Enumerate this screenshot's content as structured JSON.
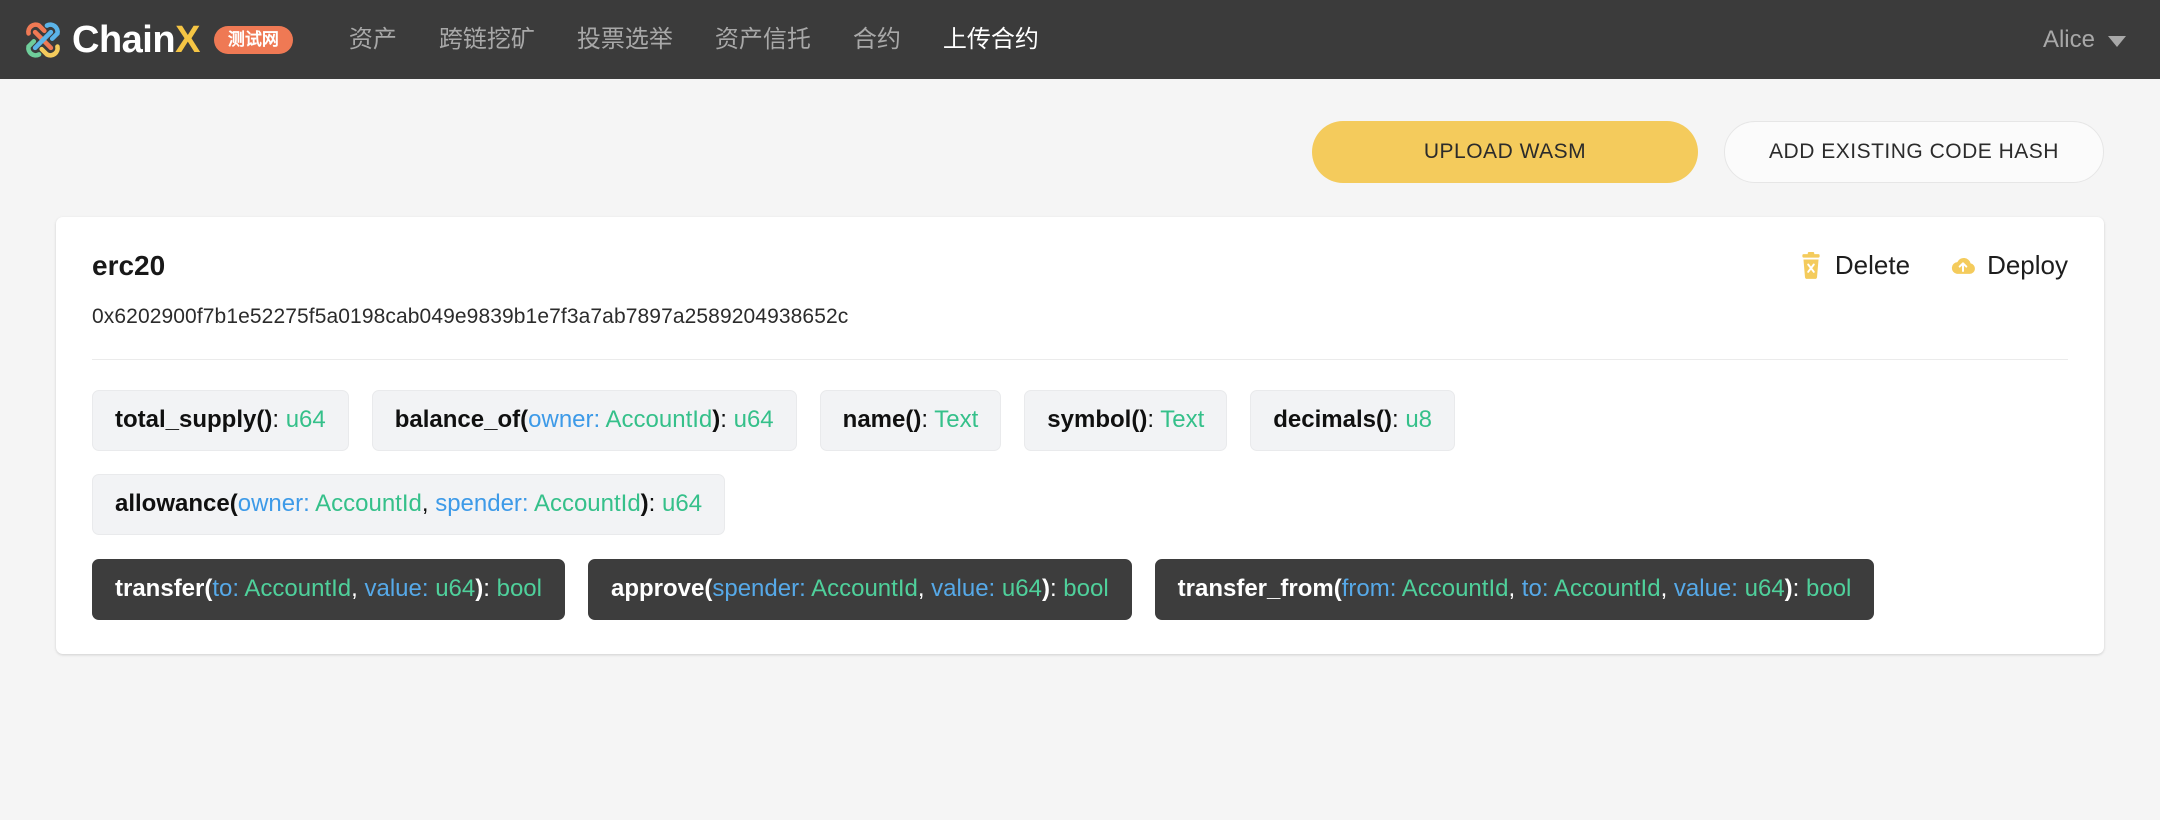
{
  "topbar": {
    "brand": {
      "name_main": "Chain",
      "name_accent": "X",
      "badge": "测试网",
      "logo_icon": "chainx-knot-logo-icon"
    },
    "nav": [
      {
        "label": "资产",
        "active": false
      },
      {
        "label": "跨链挖矿",
        "active": false
      },
      {
        "label": "投票选举",
        "active": false
      },
      {
        "label": "资产信托",
        "active": false
      },
      {
        "label": "合约",
        "active": false
      },
      {
        "label": "上传合约",
        "active": true
      }
    ],
    "account": {
      "name": "Alice",
      "caret_icon": "chevron-down-icon"
    }
  },
  "actionbar": {
    "upload_wasm": "UPLOAD WASM",
    "add_existing_code_hash": "ADD EXISTING CODE HASH"
  },
  "card": {
    "title": "erc20",
    "hash": "0x6202900f7b1e52275f5a0198cab049e9839b1e7f3a7ab7897a2589204938652c",
    "delete_label": "Delete",
    "delete_icon": "trash-icon",
    "deploy_label": "Deploy",
    "deploy_icon": "cloud-upload-icon",
    "methods_readonly": [
      {
        "name": "total_supply",
        "params": [],
        "returns": "u64"
      },
      {
        "name": "balance_of",
        "params": [
          {
            "pname": "owner",
            "ptype": "AccountId"
          }
        ],
        "returns": "u64"
      },
      {
        "name": "name",
        "params": [],
        "returns": "Text"
      },
      {
        "name": "symbol",
        "params": [],
        "returns": "Text"
      },
      {
        "name": "decimals",
        "params": [],
        "returns": "u8"
      },
      {
        "name": "allowance",
        "params": [
          {
            "pname": "owner",
            "ptype": "AccountId"
          },
          {
            "pname": "spender",
            "ptype": "AccountId"
          }
        ],
        "returns": "u64"
      }
    ],
    "methods_mutable": [
      {
        "name": "transfer",
        "params": [
          {
            "pname": "to",
            "ptype": "AccountId"
          },
          {
            "pname": "value",
            "ptype": "u64"
          }
        ],
        "returns": "bool"
      },
      {
        "name": "approve",
        "params": [
          {
            "pname": "spender",
            "ptype": "AccountId"
          },
          {
            "pname": "value",
            "ptype": "u64"
          }
        ],
        "returns": "bool"
      },
      {
        "name": "transfer_from",
        "params": [
          {
            "pname": "from",
            "ptype": "AccountId"
          },
          {
            "pname": "to",
            "ptype": "AccountId"
          },
          {
            "pname": "value",
            "ptype": "u64"
          }
        ],
        "returns": "bool"
      }
    ]
  },
  "colors": {
    "topbar_bg": "#3b3b3b",
    "accent_yellow": "#f4cb5c",
    "badge_orange": "#ef7954",
    "param_blue": "#3d9ae8",
    "type_green": "#35c08a",
    "chip_dark_bg": "#3d3d3d",
    "chip_light_bg": "#f2f3f5",
    "page_bg": "#f5f5f5"
  }
}
